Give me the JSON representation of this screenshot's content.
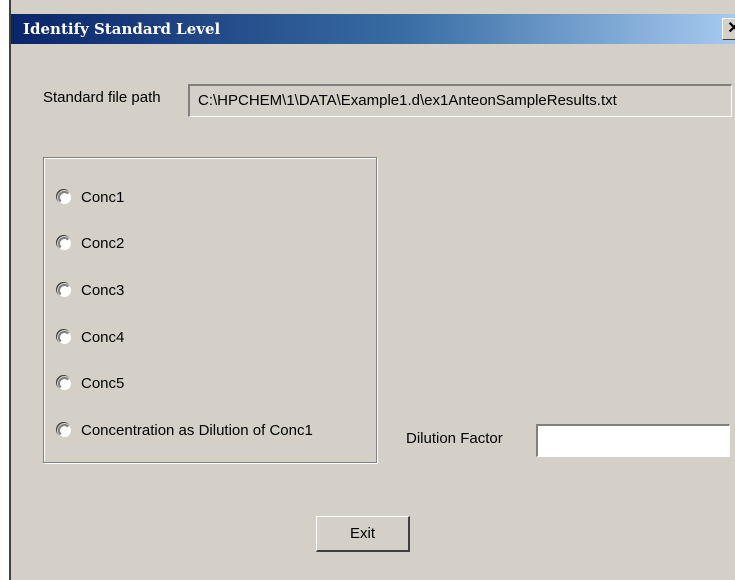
{
  "window": {
    "title": "Identify Standard Level",
    "close_label": "✕"
  },
  "standard_file": {
    "label": "Standard file path",
    "value": "C:\\HPCHEM\\1\\DATA\\Example1.d\\ex1AnteonSampleResults.txt"
  },
  "options": [
    {
      "label": "Conc1",
      "selected": false
    },
    {
      "label": "Conc2",
      "selected": false
    },
    {
      "label": "Conc3",
      "selected": false
    },
    {
      "label": "Conc4",
      "selected": false
    },
    {
      "label": "Conc5",
      "selected": false
    },
    {
      "label": "Concentration as Dilution of Conc1",
      "selected": false
    }
  ],
  "dilution": {
    "label": "Dilution Factor",
    "value": ""
  },
  "exit_button": {
    "label": "Exit"
  }
}
